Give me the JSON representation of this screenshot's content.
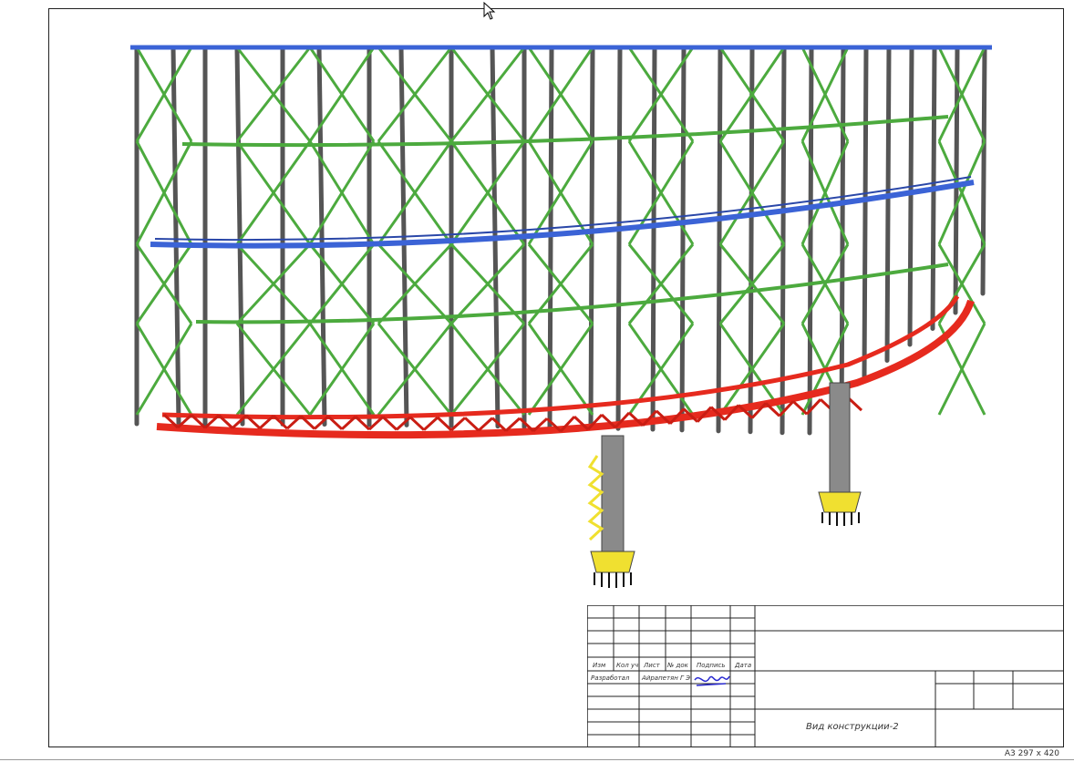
{
  "stamp": {
    "headers": [
      "Изм",
      "Кол уч",
      "Лист",
      "№ док",
      "Подпись",
      "Дата"
    ],
    "role": "Разработал",
    "name": "Айрапетян Г Э",
    "title": "Вид конструкции-2"
  },
  "sheet_format": "А3 297 х 420",
  "colors": {
    "top_ring": "#3b63d6",
    "mid_ring": "#3b63d6",
    "green_ring": "#4caa3e",
    "bottom_truss": "#e62a1e",
    "column": "#8a8a8a",
    "accent": "#f0e030",
    "signature": "#2a2ad0"
  },
  "icons": [
    "cursor-icon"
  ]
}
